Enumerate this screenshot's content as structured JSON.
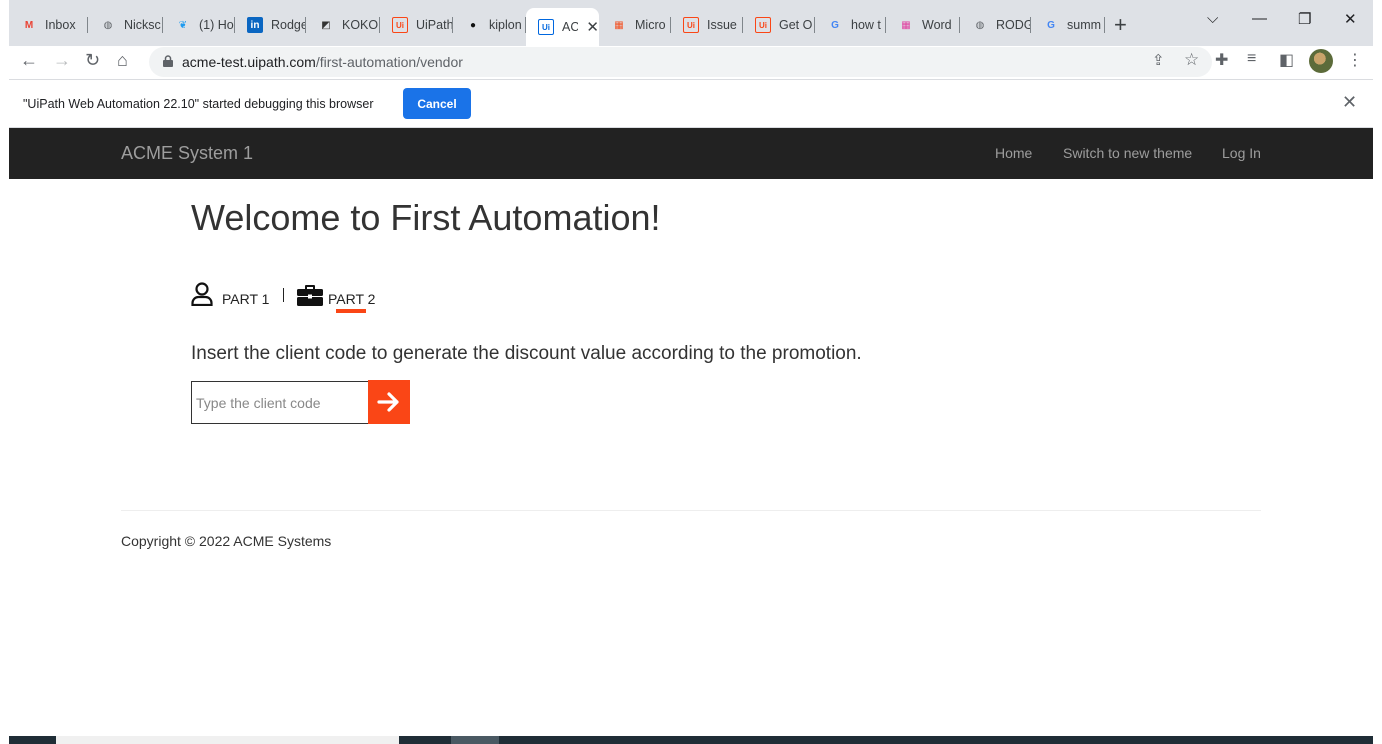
{
  "browser": {
    "tabs": [
      {
        "title": "Inbox",
        "icon": "gmail-icon",
        "color": "#ea4335",
        "glyph": "M"
      },
      {
        "title": "Nicksc",
        "icon": "globe-icon",
        "color": "#5f6368",
        "glyph": "◍"
      },
      {
        "title": "(1) Ho",
        "icon": "twitter-icon",
        "color": "#1d9bf0",
        "glyph": "❦"
      },
      {
        "title": "Rodge",
        "icon": "linkedin-icon",
        "color": "#0a66c2",
        "glyph": "in"
      },
      {
        "title": "KOKO",
        "icon": "koko-icon",
        "color": "#333333",
        "glyph": "◩"
      },
      {
        "title": "UiPath",
        "icon": "uipath-icon",
        "color": "#fa4616",
        "glyph": "Ui"
      },
      {
        "title": "kiplon",
        "icon": "github-icon",
        "color": "#111111",
        "glyph": "●"
      },
      {
        "title": "AC",
        "icon": "uipath-icon",
        "color": "#0067df",
        "glyph": "Ui",
        "active": true
      },
      {
        "title": "Micro",
        "icon": "microsoft-icon",
        "color": "#f25022",
        "glyph": "▦"
      },
      {
        "title": "Issue",
        "icon": "uipath-icon",
        "color": "#fa4616",
        "glyph": "Ui"
      },
      {
        "title": "Get O",
        "icon": "uipath-icon",
        "color": "#fa4616",
        "glyph": "Ui"
      },
      {
        "title": "how t",
        "icon": "google-icon",
        "color": "#4285f4",
        "glyph": "G"
      },
      {
        "title": "Word",
        "icon": "colorful-icon",
        "color": "#e040a0",
        "glyph": "▦"
      },
      {
        "title": "RODG",
        "icon": "globe-icon",
        "color": "#5f6368",
        "glyph": "◍"
      },
      {
        "title": "summ",
        "icon": "google-icon",
        "color": "#4285f4",
        "glyph": "G"
      }
    ],
    "url_host": "acme-test.uipath.com",
    "url_path": "/first-automation/vendor"
  },
  "infobar": {
    "message": "\"UiPath Web Automation 22.10\" started debugging this browser",
    "cancel_label": "Cancel"
  },
  "navbar": {
    "brand": "ACME System 1",
    "links": [
      "Home",
      "Switch to new theme",
      "Log In"
    ]
  },
  "main": {
    "heading": "Welcome to First Automation!",
    "part1_label": "PART 1",
    "part2_label": "PART 2",
    "description": "Insert the client code to generate the discount value according to the promotion.",
    "input_placeholder": "Type the client code",
    "input_value": "",
    "accent_color": "#fa4616"
  },
  "footer": {
    "copyright": "Copyright © 2022 ACME Systems"
  }
}
